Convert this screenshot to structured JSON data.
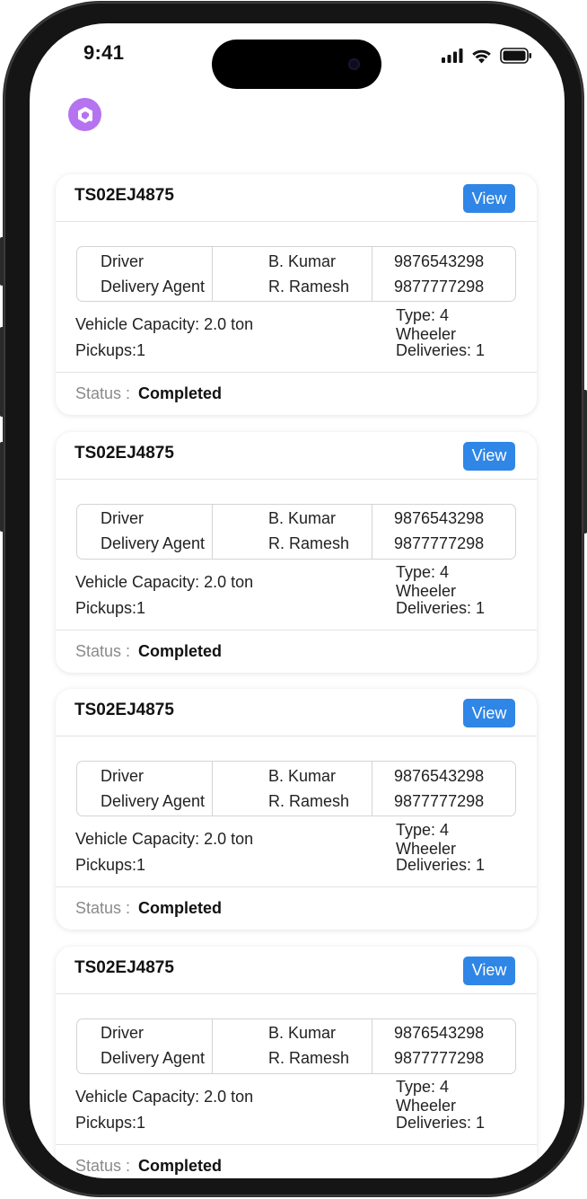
{
  "status_bar": {
    "time": "9:41"
  },
  "trips": [
    {
      "vehicle_number": "TS02EJ4875",
      "view_label": "View",
      "crew": {
        "roles": [
          "Driver",
          "Delivery Agent"
        ],
        "names": [
          "B. Kumar",
          "R. Ramesh"
        ],
        "phones": [
          "9876543298",
          "9877777298"
        ]
      },
      "capacity": "Vehicle Capacity: 2.0 ton",
      "type": "Type: 4 Wheeler",
      "pickups": "Pickups:1",
      "deliveries": "Deliveries: 1",
      "status_label": "Status :",
      "status_value": "Completed"
    },
    {
      "vehicle_number": "TS02EJ4875",
      "view_label": "View",
      "crew": {
        "roles": [
          "Driver",
          "Delivery Agent"
        ],
        "names": [
          "B. Kumar",
          "R. Ramesh"
        ],
        "phones": [
          "9876543298",
          "9877777298"
        ]
      },
      "capacity": "Vehicle Capacity: 2.0 ton",
      "type": "Type: 4 Wheeler",
      "pickups": "Pickups:1",
      "deliveries": "Deliveries: 1",
      "status_label": "Status :",
      "status_value": "Completed"
    },
    {
      "vehicle_number": "TS02EJ4875",
      "view_label": "View",
      "crew": {
        "roles": [
          "Driver",
          "Delivery Agent"
        ],
        "names": [
          "B. Kumar",
          "R. Ramesh"
        ],
        "phones": [
          "9876543298",
          "9877777298"
        ]
      },
      "capacity": "Vehicle Capacity: 2.0 ton",
      "type": "Type: 4 Wheeler",
      "pickups": "Pickups:1",
      "deliveries": "Deliveries: 1",
      "status_label": "Status :",
      "status_value": "Completed"
    },
    {
      "vehicle_number": "TS02EJ4875",
      "view_label": "View",
      "crew": {
        "roles": [
          "Driver",
          "Delivery Agent"
        ],
        "names": [
          "B. Kumar",
          "R. Ramesh"
        ],
        "phones": [
          "9876543298",
          "9877777298"
        ]
      },
      "capacity": "Vehicle Capacity: 2.0 ton",
      "type": "Type: 4 Wheeler",
      "pickups": "Pickups:1",
      "deliveries": "Deliveries: 1",
      "status_label": "Status :",
      "status_value": "Completed"
    }
  ],
  "icons": {
    "logo": "app-logo-icon",
    "signal": "cellular-signal-icon",
    "wifi": "wifi-icon",
    "battery": "battery-icon"
  },
  "colors": {
    "accent": "#2f86e6",
    "logo": "#b573f0"
  }
}
